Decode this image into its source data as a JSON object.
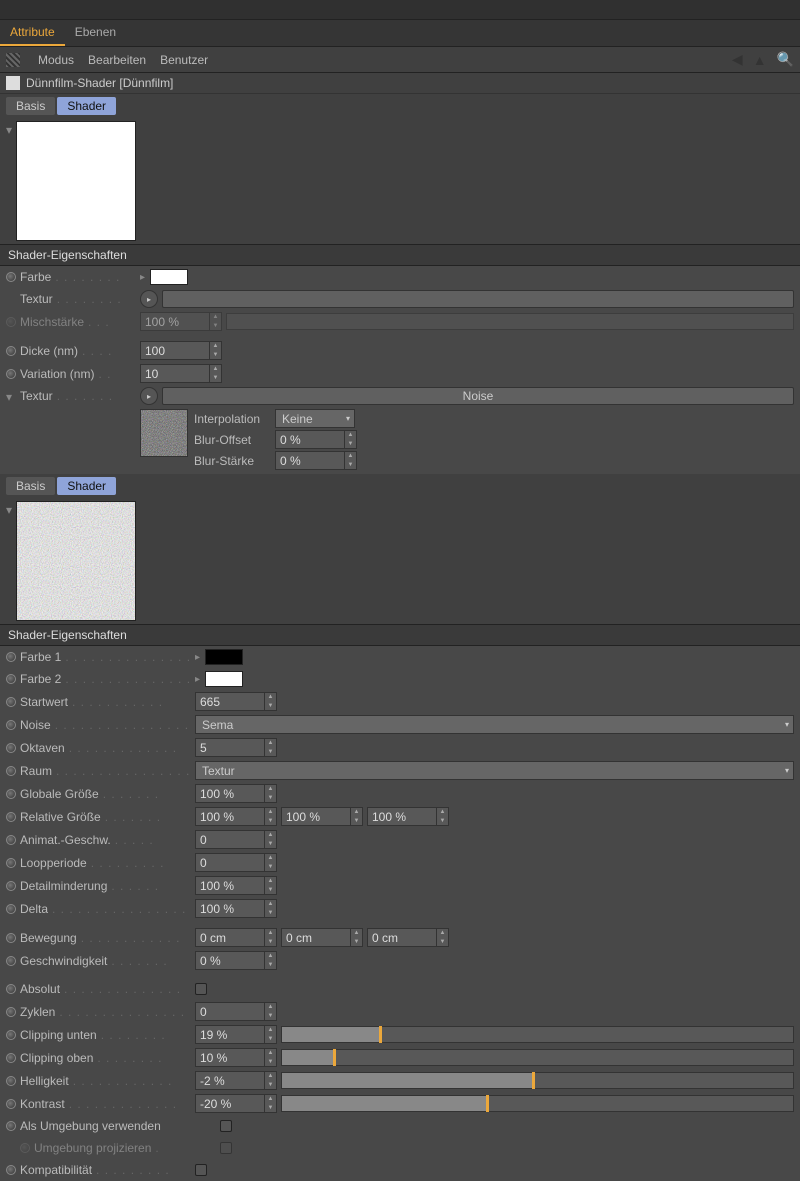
{
  "main_tabs": {
    "attribute": "Attribute",
    "ebenen": "Ebenen"
  },
  "menubar": {
    "modus": "Modus",
    "bearbeiten": "Bearbeiten",
    "benutzer": "Benutzer"
  },
  "title": "Dünnfilm-Shader [Dünnfilm]",
  "subtabs": {
    "basis": "Basis",
    "shader": "Shader"
  },
  "section_shader_props": "Shader-Eigenschaften",
  "upper": {
    "farbe": "Farbe",
    "textur": "Textur",
    "mischstaerke": "Mischstärke",
    "mischstaerke_val": "100 %",
    "dicke": "Dicke (nm)",
    "dicke_val": "100",
    "variation": "Variation (nm)",
    "variation_val": "10",
    "textur2": "Textur",
    "noise_label": "Noise",
    "interpolation": "Interpolation",
    "interp_val": "Keine",
    "blur_offset": "Blur-Offset",
    "blur_offset_val": "0 %",
    "blur_staerke": "Blur-Stärke",
    "blur_staerke_val": "0 %"
  },
  "lower": {
    "farbe1": "Farbe 1",
    "farbe2": "Farbe 2",
    "startwert": "Startwert",
    "startwert_val": "665",
    "noise": "Noise",
    "noise_val": "Sema",
    "oktaven": "Oktaven",
    "oktaven_val": "5",
    "raum": "Raum",
    "raum_val": "Textur",
    "glob_groesse": "Globale Größe",
    "glob_groesse_val": "100 %",
    "rel_groesse": "Relative Größe",
    "rel_val1": "100 %",
    "rel_val2": "100 %",
    "rel_val3": "100 %",
    "anim": "Animat.-Geschw.",
    "anim_val": "0",
    "loop": "Loopperiode",
    "loop_val": "0",
    "detail": "Detailminderung",
    "detail_val": "100 %",
    "delta": "Delta",
    "delta_val": "100 %",
    "bewegung": "Bewegung",
    "bew1": "0 cm",
    "bew2": "0 cm",
    "bew3": "0 cm",
    "geschw": "Geschwindigkeit",
    "geschw_val": "0 %",
    "absolut": "Absolut",
    "zyklen": "Zyklen",
    "zyklen_val": "0",
    "clip_u": "Clipping unten",
    "clip_u_val": "19 %",
    "clip_u_pct": 19,
    "clip_o": "Clipping oben",
    "clip_o_val": "10 %",
    "clip_o_pct": 10,
    "hell": "Helligkeit",
    "hell_val": "-2 %",
    "hell_pct": 49,
    "kontrast": "Kontrast",
    "kontrast_val": "-20 %",
    "kontrast_pct": 40,
    "als_umg": "Als Umgebung verwenden",
    "umg_proj": "Umgebung projizieren",
    "kompat": "Kompatibilität"
  }
}
